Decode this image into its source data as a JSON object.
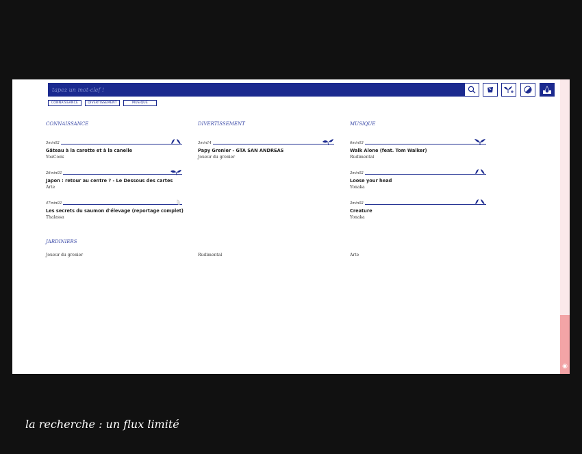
{
  "search": {
    "placeholder": "tapez un mot-clef !"
  },
  "toolbar": {
    "icons": [
      "search-icon",
      "cup-icon",
      "sprout-plus-icon",
      "half-circle-icon",
      "drop-icon"
    ]
  },
  "filters": [
    "CONNAISSANCE",
    "DIVERTISSEMENT",
    "MUSIQUE"
  ],
  "columns": [
    {
      "title": "CONNAISSANCE",
      "items": [
        {
          "duration": "5min02",
          "title": "Gâteau à la carotte et à la canelle",
          "source": "YouCook",
          "icon": "sprout-icon"
        },
        {
          "duration": "26min02",
          "title": "Japon : retour au centre ? - Le Dessous des cartes",
          "source": "Arte",
          "icon": "leaves-icon"
        },
        {
          "duration": "47min02",
          "title": "Les secrets du saumon d'élevage (reportage complet)",
          "source": "Thalassa",
          "icon": "seed-icon"
        }
      ]
    },
    {
      "title": "DIVERTISSEMENT",
      "items": [
        {
          "duration": "3min14",
          "title": "Papy Grenier - GTA SAN ANDREAS",
          "source": "Joueur du grenier",
          "icon": "leaves-icon"
        }
      ]
    },
    {
      "title": "MUSIQUE",
      "items": [
        {
          "duration": "6min03",
          "title": "Walk Alone (feat. Tom Walker)",
          "source": "Rudimental",
          "icon": "plant-icon"
        },
        {
          "duration": "3min02",
          "title": "Loose your head",
          "source": "Yonaka",
          "icon": "sprout-icon"
        },
        {
          "duration": "3min02",
          "title": "Creature",
          "source": "Yonaka",
          "icon": "sprout-icon"
        }
      ]
    }
  ],
  "jardiniers": {
    "title": "JARDINIERS",
    "names": [
      "Joueur du grenier",
      "Rudimental",
      "Arte"
    ]
  },
  "caption": "la recherche : un flux limité",
  "colors": {
    "accent": "#1b2a8f",
    "scrollbar": "#f3a4a6",
    "background": "#111111"
  }
}
